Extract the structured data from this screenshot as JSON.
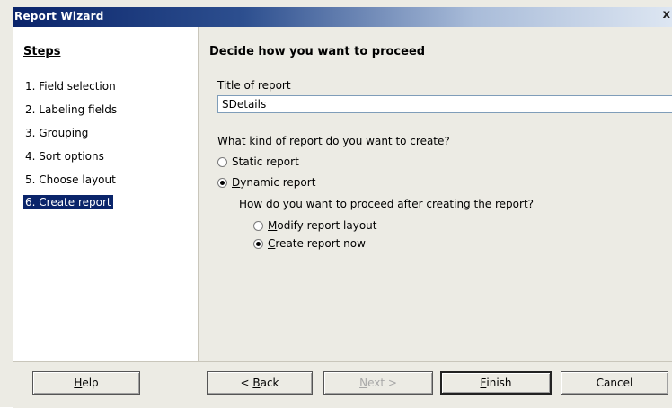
{
  "window": {
    "title": "Report Wizard",
    "close_glyph": "x"
  },
  "steps": {
    "header": "Steps",
    "items": [
      {
        "label": "1. Field selection",
        "selected": false
      },
      {
        "label": "2. Labeling fields",
        "selected": false
      },
      {
        "label": "3. Grouping",
        "selected": false
      },
      {
        "label": "4. Sort options",
        "selected": false
      },
      {
        "label": "5. Choose layout",
        "selected": false
      },
      {
        "label": "6. Create report",
        "selected": true
      }
    ]
  },
  "content": {
    "title": "Decide how you want to proceed",
    "report_title_label": "Title of report",
    "report_title_value": "SDetails",
    "kind_question": "What kind of report do you want to create?",
    "kind_options": [
      {
        "pre": "",
        "key": "",
        "rest": "Static report",
        "selected": false
      },
      {
        "pre": "",
        "key": "D",
        "rest": "ynamic report",
        "selected": true
      }
    ],
    "proceed_question": "How do you want to proceed after creating the report?",
    "proceed_options": [
      {
        "pre": "",
        "key": "M",
        "rest": "odify report layout",
        "selected": false
      },
      {
        "pre": "",
        "key": "C",
        "rest": "reate report now",
        "selected": true
      }
    ]
  },
  "buttons": {
    "help": {
      "key": "H",
      "rest": "elp"
    },
    "back": {
      "pre": "< ",
      "key": "B",
      "rest": "ack"
    },
    "next": {
      "pre": "",
      "key": "N",
      "rest": "ext >"
    },
    "finish": {
      "pre": "",
      "key": "F",
      "rest": "inish"
    },
    "cancel": "Cancel"
  },
  "colors": {
    "selection": "#0a246a",
    "titlebar_start": "#0a246a",
    "dialog_bg": "#ecebe4"
  }
}
